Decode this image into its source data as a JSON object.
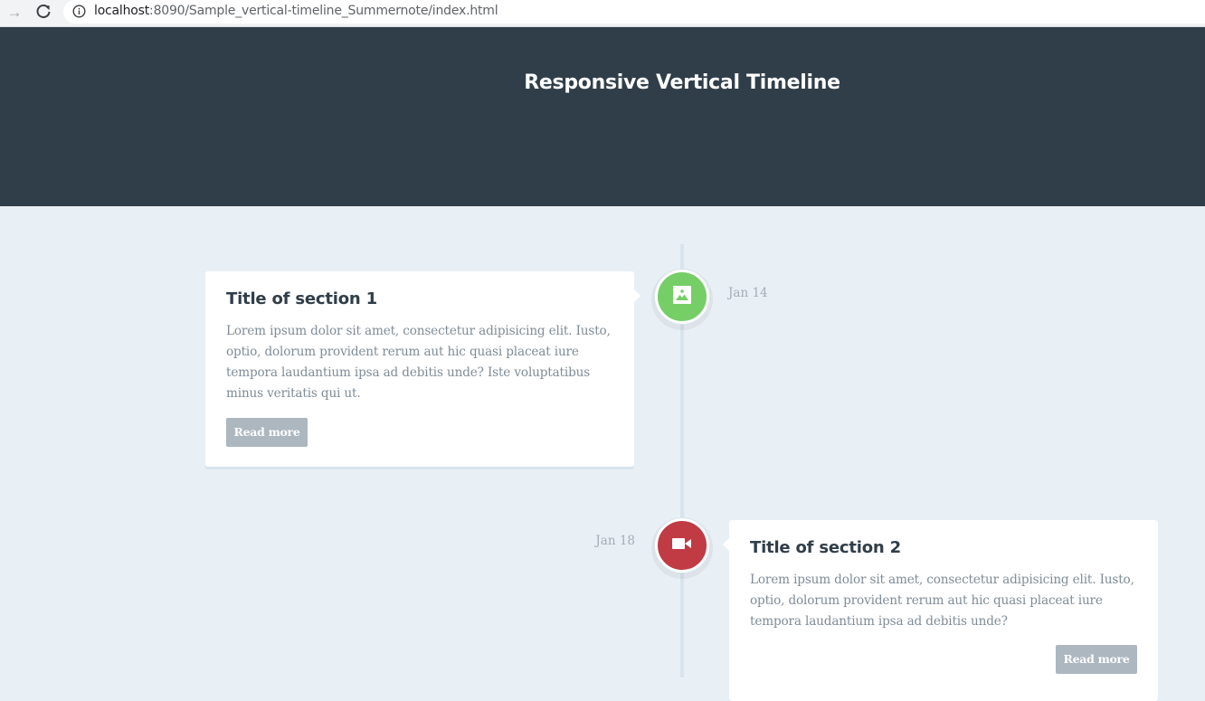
{
  "browser": {
    "url_host": "localhost",
    "url_path": ":8090/Sample_vertical-timeline_Summernote/index.html"
  },
  "header": {
    "title": "Responsive Vertical Timeline"
  },
  "timeline": {
    "items": [
      {
        "icon": "picture-icon",
        "color": "#75ce66",
        "title": "Title of section 1",
        "text": "Lorem ipsum dolor sit amet, consectetur adipisicing elit. Iusto, optio, dolorum provident rerum aut hic quasi placeat iure tempora laudantium ipsa ad debitis unde? Iste voluptatibus minus veritatis qui ut.",
        "button": "Read more",
        "date": "Jan 14"
      },
      {
        "icon": "video-icon",
        "color": "#c03b44",
        "title": "Title of section 2",
        "text": "Lorem ipsum dolor sit amet, consectetur adipisicing elit. Iusto, optio, dolorum provident rerum aut hic quasi placeat iure tempora laudantium ipsa ad debitis unde?",
        "button": "Read more",
        "date": "Jan 18"
      }
    ]
  },
  "colors": {
    "header_bg": "#303e49",
    "page_bg": "#e9f0f5",
    "button_bg": "#acb7c0"
  }
}
